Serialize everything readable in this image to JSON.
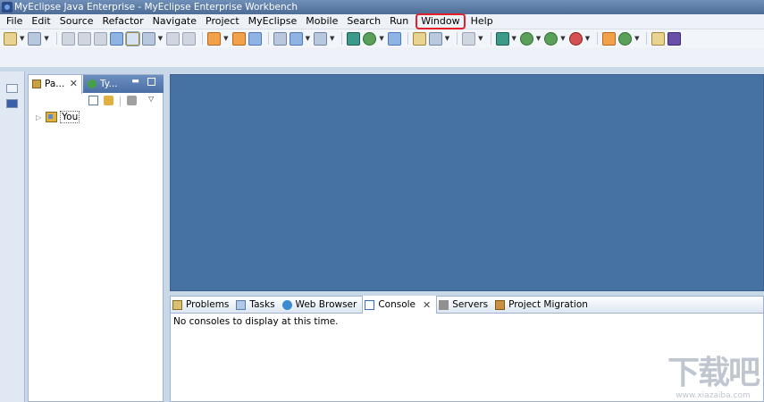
{
  "window": {
    "title": "MyEclipse Java Enterprise - MyEclipse Enterprise Workbench"
  },
  "menu": {
    "items": [
      {
        "label": "File",
        "name": "menu-file"
      },
      {
        "label": "Edit",
        "name": "menu-edit"
      },
      {
        "label": "Source",
        "name": "menu-source"
      },
      {
        "label": "Refactor",
        "name": "menu-refactor"
      },
      {
        "label": "Navigate",
        "name": "menu-navigate"
      },
      {
        "label": "Project",
        "name": "menu-project"
      },
      {
        "label": "MyEclipse",
        "name": "menu-myeclipse"
      },
      {
        "label": "Mobile",
        "name": "menu-mobile"
      },
      {
        "label": "Search",
        "name": "menu-search"
      },
      {
        "label": "Run",
        "name": "menu-run"
      },
      {
        "label": "Window",
        "name": "menu-window",
        "highlight": true
      },
      {
        "label": "Help",
        "name": "menu-help"
      }
    ],
    "highlight_color": "#e0202a"
  },
  "package_explorer": {
    "tabs": [
      {
        "label": "Pa...",
        "icon": "package-explorer-icon"
      },
      {
        "label": "Ty...",
        "icon": "type-hierarchy-icon"
      }
    ],
    "tree": [
      {
        "label": "You",
        "icon": "project-folder-icon"
      }
    ]
  },
  "console": {
    "tabs": [
      {
        "label": "Problems",
        "icon": "problems-icon"
      },
      {
        "label": "Tasks",
        "icon": "tasks-icon"
      },
      {
        "label": "Web Browser",
        "icon": "web-browser-icon"
      },
      {
        "label": "Console",
        "icon": "console-icon",
        "active": true
      },
      {
        "label": "Servers",
        "icon": "servers-icon"
      },
      {
        "label": "Project Migration",
        "icon": "project-migration-icon"
      }
    ],
    "message": "No consoles to display at this time."
  },
  "watermark": {
    "logo": "下载吧",
    "url": "www.xiazaiba.com"
  },
  "colors": {
    "editor_background": "#4672a3",
    "titlebar": "#5a7aa5"
  }
}
